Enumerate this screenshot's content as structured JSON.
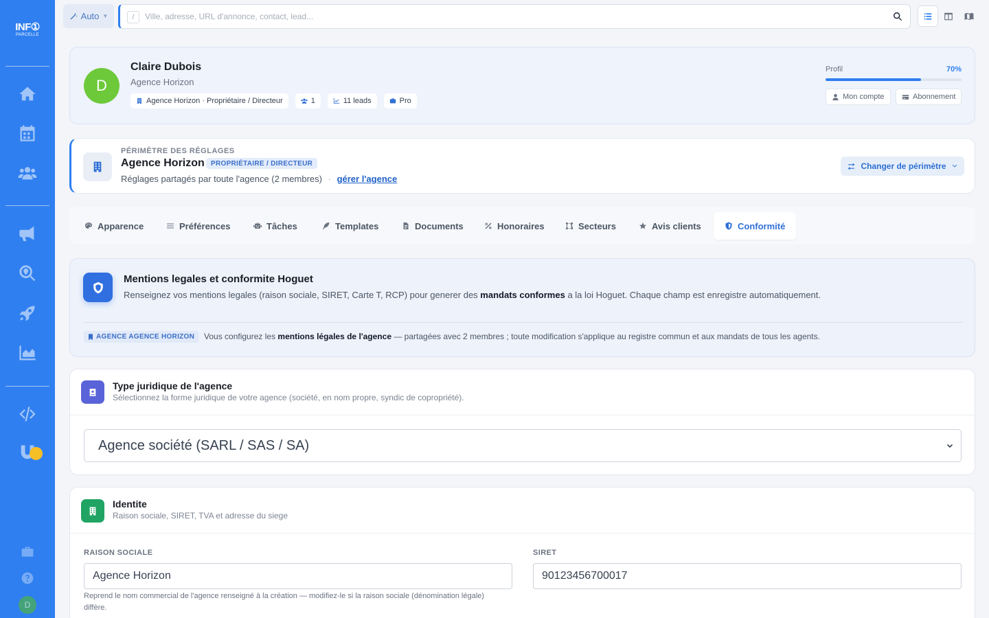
{
  "brand": {
    "line1": "INF①",
    "line2": "PARCELLE"
  },
  "topbar": {
    "mode_label": "Auto",
    "search_key": "/",
    "search_placeholder": "Ville, adresse, URL d'annonce, contact, lead..."
  },
  "profile": {
    "initial": "D",
    "name": "Claire Dubois",
    "agency": "Agence Horizon",
    "chips": [
      "Agence Horizon · Propriétaire / Directeur",
      "1",
      "11 leads",
      "Pro"
    ],
    "progress_label": "Profil",
    "progress_pct": "70%",
    "progress_value": 0.7,
    "account_btn": "Mon compte",
    "subscription_btn": "Abonnement"
  },
  "scope": {
    "overline": "PÉRIMÈTRE DES RÉGLAGES",
    "title": "Agence Horizon",
    "badge": "PROPRIÉTAIRE / DIRECTEUR",
    "subtitle": "Réglages partagés par toute l'agence (2 membres)",
    "separator": "·",
    "manage_link": "gérer l'agence",
    "change_btn": "Changer de périmètre"
  },
  "tabs": [
    {
      "label": "Apparence",
      "icon": "palette-icon"
    },
    {
      "label": "Préférences",
      "icon": "sliders-icon"
    },
    {
      "label": "Tâches",
      "icon": "robot-icon"
    },
    {
      "label": "Templates",
      "icon": "feather-icon"
    },
    {
      "label": "Documents",
      "icon": "file-icon"
    },
    {
      "label": "Honoraires",
      "icon": "percent-icon"
    },
    {
      "label": "Secteurs",
      "icon": "map-icon"
    },
    {
      "label": "Avis clients",
      "icon": "star-icon"
    },
    {
      "label": "Conformité",
      "icon": "shield-icon",
      "active": true
    }
  ],
  "banner": {
    "title": "Mentions legales et conformite Hoguet",
    "text_before": "Renseignez vos mentions legales (raison sociale, SIRET, Carte T, RCP) pour generer des ",
    "text_bold": "mandats conformes",
    "text_after": " a la loi Hoguet. Chaque champ est enregistre automatiquement.",
    "badge": "AGENCE AGENCE HORIZON",
    "note_before": "Vous configurez les ",
    "note_bold": "mentions légales de l'agence",
    "note_after": " — partagées avec 2 membres ; toute modification s'applique au registre commun et aux mandats de tous les agents."
  },
  "type_section": {
    "title": "Type juridique de l'agence",
    "subtitle": "Sélectionnez la forme juridique de votre agence (société, en nom propre, syndic de copropriété).",
    "selected": "Agence société (SARL / SAS / SA)"
  },
  "identity": {
    "title": "Identite",
    "subtitle": "Raison sociale, SIRET, TVA et adresse du siege",
    "raison_label": "RAISON SOCIALE",
    "raison_value": "Agence Horizon",
    "siret_label": "SIRET",
    "siret_value": "90123456700017",
    "help": "Reprend le nom commercial de l'agence renseigné à la création — modifiez-le si la raison sociale (dénomination légale) diffère."
  },
  "colors": {
    "accent": "#2f7ff0",
    "sidebar": "#2f7ff0",
    "avatar": "#6dc93a",
    "identity_icon": "#1fa463",
    "type_icon": "#5a63d8"
  }
}
